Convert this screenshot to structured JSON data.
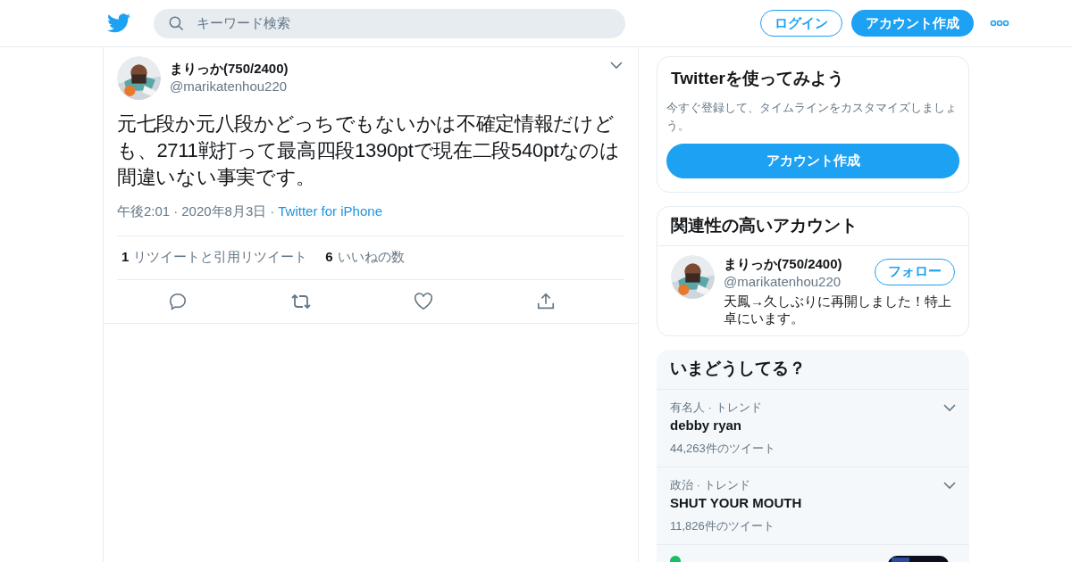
{
  "header": {
    "search": {
      "placeholder": "キーワード検索"
    },
    "login": "ログイン",
    "signup": "アカウント作成"
  },
  "tweet": {
    "name": "まりっか(750/2400)",
    "handle": "@marikatenhou220",
    "text": "元七段か元八段かどっちでもないかは不確定情報だけども、2711戦打って最高四段1390ptで現在二段540ptなのは間違いない事実です。",
    "time": "午後2:01",
    "separator": "·",
    "date": "2020年8月3日",
    "source": "Twitter for iPhone",
    "stats": [
      {
        "count": "1",
        "label": "リツイートと引用リツイート"
      },
      {
        "count": "6",
        "label": "いいねの数"
      }
    ]
  },
  "signup_card": {
    "title": "Twitterを使ってみよう",
    "text": "今すぐ登録して、タイムラインをカスタマイズしましょう。",
    "button": "アカウント作成"
  },
  "related": {
    "title": "関連性の高いアカウント",
    "account": {
      "name": "まりっか(750/2400)",
      "handle": "@marikatenhou220",
      "bio": "天鳳→久しぶりに再開しました！特上卓にいます。",
      "button": "フォロー"
    }
  },
  "trends": {
    "title": "いまどうしてる？",
    "items": [
      {
        "kind": "trend",
        "context": "有名人 · トレンド",
        "name": "debby ryan",
        "count": "44,263件のツイート"
      },
      {
        "kind": "trend",
        "context": "政治 · トレンド",
        "name": "SHUT YOUR MOUTH",
        "count": "11,826件のツイート"
      },
      {
        "kind": "news"
      }
    ]
  }
}
